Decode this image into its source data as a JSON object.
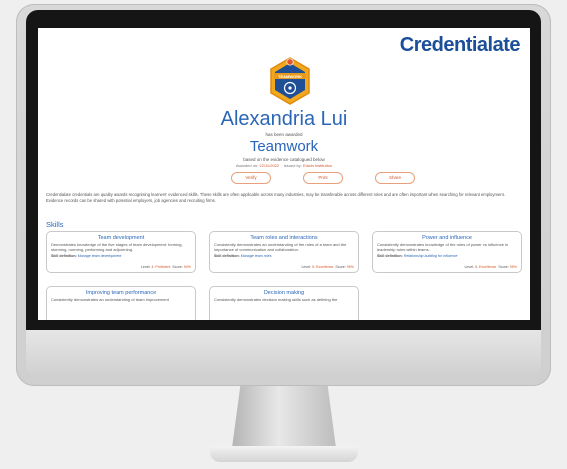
{
  "brand": {
    "name": "Credentialate"
  },
  "badge": {
    "label": "TEAMWORK"
  },
  "recipient": {
    "name": "Alexandria Lui",
    "awarded_text": "has been awarded",
    "credential": "Teamwork",
    "based_text": "based on the evidence catalogued below",
    "awarded_on_label": "Awarded on:",
    "awarded_on": "22/11/2022",
    "issued_by_label": "Issued by:",
    "issued_by": "Edwin Institution"
  },
  "buttons": {
    "verify": "Verify",
    "print": "Print",
    "share": "Share"
  },
  "description": "Credentialate credentials are quality awards recognising learners' evidenced skills. These skills are often applicable across many industries, may be transferable across different roles and are often important when searching for relevant employment. Evidence records can be shared with potential employers, job agencies and recruiting firms.",
  "skills": {
    "heading": "Skills",
    "cards": [
      {
        "title": "Team development",
        "desc": "Demonstrates knowledge of the five stages of team development: forming, storming, norming, performing and adjourning.",
        "def_label": "Skill definition:",
        "def": "Manage team development",
        "level_label": "Level:",
        "level": "4: Proficient",
        "score_label": "Score:",
        "score": "90%"
      },
      {
        "title": "Team roles and interactions",
        "desc": "Consistently demonstrates an understanding of the roles of a team and the importance of communication and collaboration.",
        "def_label": "Skill definition:",
        "def": "Manage team roles",
        "level_label": "Level:",
        "level": "5: Excellence",
        "score_label": "Score:",
        "score": "95%"
      },
      {
        "title": "Power and influence",
        "desc": "Consistently demonstrates knowledge of the roles of power vs influence in leadership roles within teams.",
        "def_label": "Skill definition:",
        "def": "Relationship building for influence",
        "level_label": "Level:",
        "level": "5: Excellence",
        "score_label": "Score:",
        "score": "95%"
      },
      {
        "title": "Improving team performance",
        "desc": "Consistently demonstrates an understanding of team improvement"
      },
      {
        "title": "Decision making",
        "desc": "Consistently demonstrates decision making skills such as defining the"
      }
    ]
  },
  "colors": {
    "accent": "#2a66b8",
    "brand": "#1b4f9a",
    "action": "#d4572a"
  }
}
